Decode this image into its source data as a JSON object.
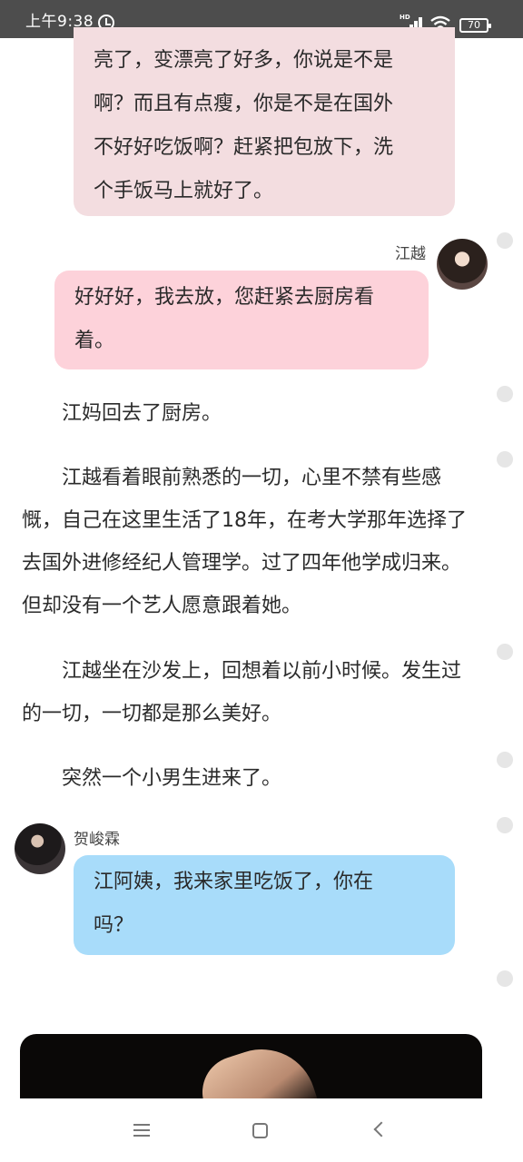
{
  "status_bar": {
    "time": "上午9:38",
    "battery": "70",
    "signal_label": "HD"
  },
  "chat": {
    "top_bubble_lines": [
      "亮了，变漂亮了好多，你说是不是",
      "啊？而且有点瘦，你是不是在国外",
      "不好好吃饭啊？赶紧把包放下，洗",
      "个手饭马上就好了。"
    ],
    "jiang_name": "江越",
    "jiang_lines": [
      "好好好，我去放，您赶紧去厨房看",
      "着。"
    ],
    "he_name": "贺峻霖",
    "he_lines": [
      "江阿姨，我来家里吃饭了，你在",
      "吗？"
    ]
  },
  "narration": {
    "p1": "江妈回去了厨房。",
    "p2": "江越看着眼前熟悉的一切，心里不禁有些感慨，自己在这里生活了18年，在考大学那年选择了去国外进修经纪人管理学。过了四年他学成归来。但却没有一个艺人愿意跟着她。",
    "p3": "江越坐在沙发上，回想着以前小时候。发生过的一切，一切都是那么美好。",
    "p4": "突然一个小男生进来了。"
  }
}
